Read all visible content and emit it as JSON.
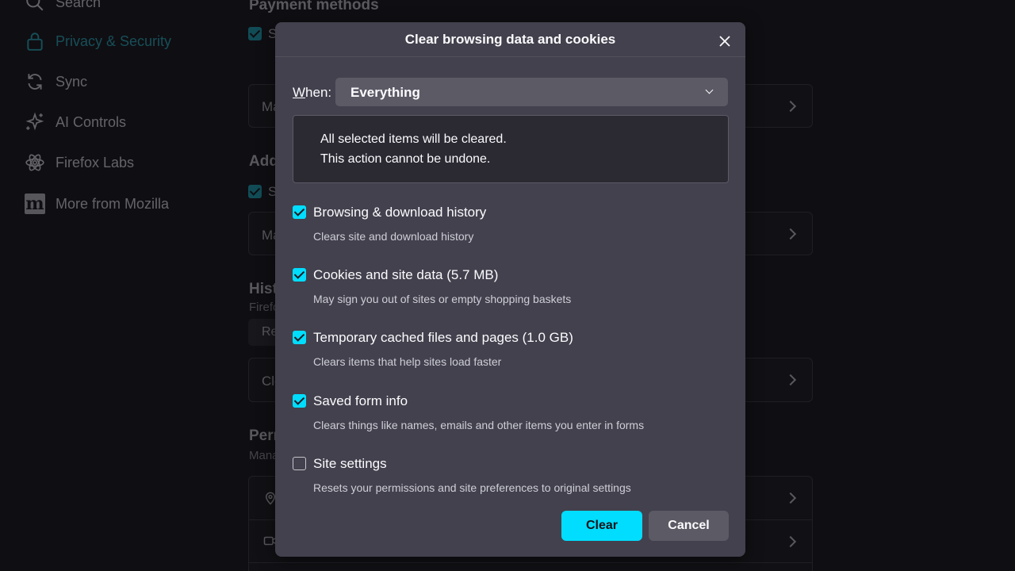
{
  "sidebar": {
    "items": [
      {
        "label": "Search",
        "icon": "search-icon"
      },
      {
        "label": "Privacy & Security",
        "icon": "lock-icon",
        "active": true
      },
      {
        "label": "Sync",
        "icon": "sync-icon"
      },
      {
        "label": "AI Controls",
        "icon": "sparkle-icon"
      },
      {
        "label": "Firefox Labs",
        "icon": "atom-icon"
      },
      {
        "label": "More from Mozilla",
        "icon": "mozilla-logo-icon"
      }
    ]
  },
  "background": {
    "payment_heading": "Payment methods",
    "addresses_heading": "Add",
    "history_heading": "Hist",
    "history_sub": "Firefo",
    "permissions_heading": "Pern",
    "permissions_sub": "Mana",
    "card_manage_1": "Ma",
    "card_manage_2": "Ma",
    "check_letter_1": "S",
    "check_letter_2": "S",
    "reset_button": "Re",
    "card_clear": "Cle"
  },
  "dialog": {
    "title": "Clear browsing data and cookies",
    "when_label_prefix": "W",
    "when_label_rest": "hen:",
    "when_value": "Everything",
    "info_line_1": "All selected items will be cleared.",
    "info_line_2": "This action cannot be undone.",
    "options": [
      {
        "label": "Browsing & download history",
        "desc": "Clears site and download history",
        "checked": true
      },
      {
        "label": "Cookies and site data (5.7 MB)",
        "desc": "May sign you out of sites or empty shopping baskets",
        "checked": true
      },
      {
        "label": "Temporary cached files and pages (1.0 GB)",
        "desc": "Clears items that help sites load faster",
        "checked": true
      },
      {
        "label": "Saved form info",
        "desc": "Clears things like names, emails and other items you enter in forms",
        "checked": true
      },
      {
        "label": "Site settings",
        "desc": "Resets your permissions and site preferences to original settings",
        "checked": false
      }
    ],
    "clear_label": "Clear",
    "cancel_label": "Cancel"
  },
  "colors": {
    "accent": "#00ddff",
    "dialog_bg": "#42414d",
    "page_bg": "#1c1b22"
  }
}
